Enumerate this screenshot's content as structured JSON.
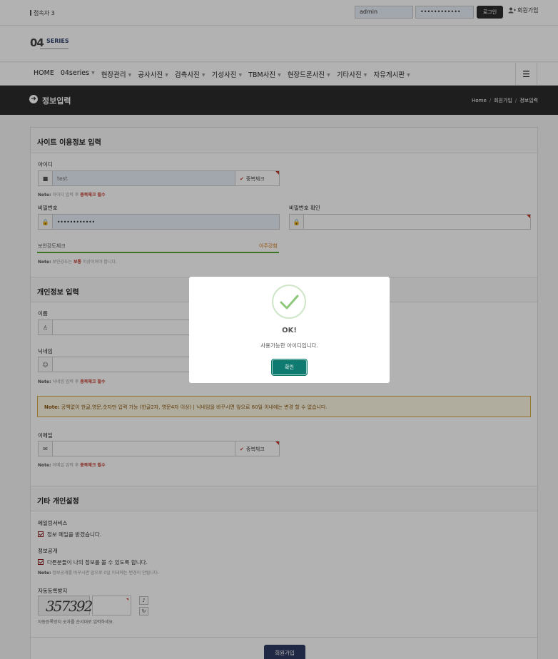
{
  "topbar": {
    "visitors": "접속자 3",
    "login_id_value": "admin",
    "login_pw_value": "••••••••••••",
    "login_button": "로그인",
    "join_link": "회원가입"
  },
  "logo": {
    "number": "04",
    "text": "SERIES"
  },
  "nav": {
    "items": [
      "HOME",
      "04series",
      "현장관리",
      "공사사진",
      "검측사진",
      "기성사진",
      "TBM사진",
      "현장드론사진",
      "기타사진",
      "자유게시판"
    ]
  },
  "page_header": {
    "title": "정보입력",
    "breadcrumb": [
      "Home",
      "회원가입",
      "정보입력"
    ]
  },
  "section_site": {
    "title": "사이트 이용정보 입력",
    "id_label": "아이디",
    "id_value": "test",
    "dup_check": "중복체크",
    "id_note_prefix": "Note:",
    "id_note_text": "아이디 입력 후",
    "id_note_red": "중복체크 필수",
    "pw_label": "비밀번호",
    "pw_value": "••••••••••••",
    "pw_confirm_label": "비밀번호 확인",
    "strength_label": "보안강도체크",
    "strength_value": "아주강함",
    "strength_note_prefix": "Note:",
    "strength_note_a": "보안강도는",
    "strength_note_red": "보통",
    "strength_note_b": "이상이어야 합니다."
  },
  "section_personal": {
    "title": "개인정보 입력",
    "name_label": "이름",
    "nick_label": "닉네임",
    "nick_note_prefix": "Note:",
    "nick_note_text": "닉네임 입력 후",
    "nick_note_red": "중복체크 필수",
    "warning_prefix": "Note:",
    "warning_text": "공백없이 한글,영문,숫자만 입력 가능 (한글2자, 영문4자 이상) | 닉네임을 바꾸시면 앞으로 60일 이내에는 변경 할 수 없습니다.",
    "email_label": "이메일",
    "email_note_prefix": "Note:",
    "email_note_text": "이메일 입력 후",
    "email_note_red": "중복체크 필수"
  },
  "section_other": {
    "title": "기타 개인설정",
    "mailing_label": "메일링서비스",
    "mailing_check": "정보 메일을 받겠습니다.",
    "public_label": "정보공개",
    "public_check": "다른분들이 나의 정보를 볼 수 있도록 합니다.",
    "public_note_prefix": "Note:",
    "public_note_text": "정보공개를 바꾸시면 앞으로 0일 이내에는 변경이 안됩니다.",
    "captcha_label": "자동등록방지",
    "captcha_text": "357392",
    "captcha_note": "자동등록방지 숫자를 순서대로 입력하세요.",
    "submit": "회원가입"
  },
  "modal": {
    "title": "OK!",
    "message": "사용가능한 아이디입니다.",
    "button": "확인"
  },
  "colors": {
    "dark_header": "#2b2b2b",
    "accent_red": "#c0392b",
    "strength_green": "#5aa832",
    "modal_button": "#0f7a6f",
    "submit_button": "#2d3a63"
  }
}
